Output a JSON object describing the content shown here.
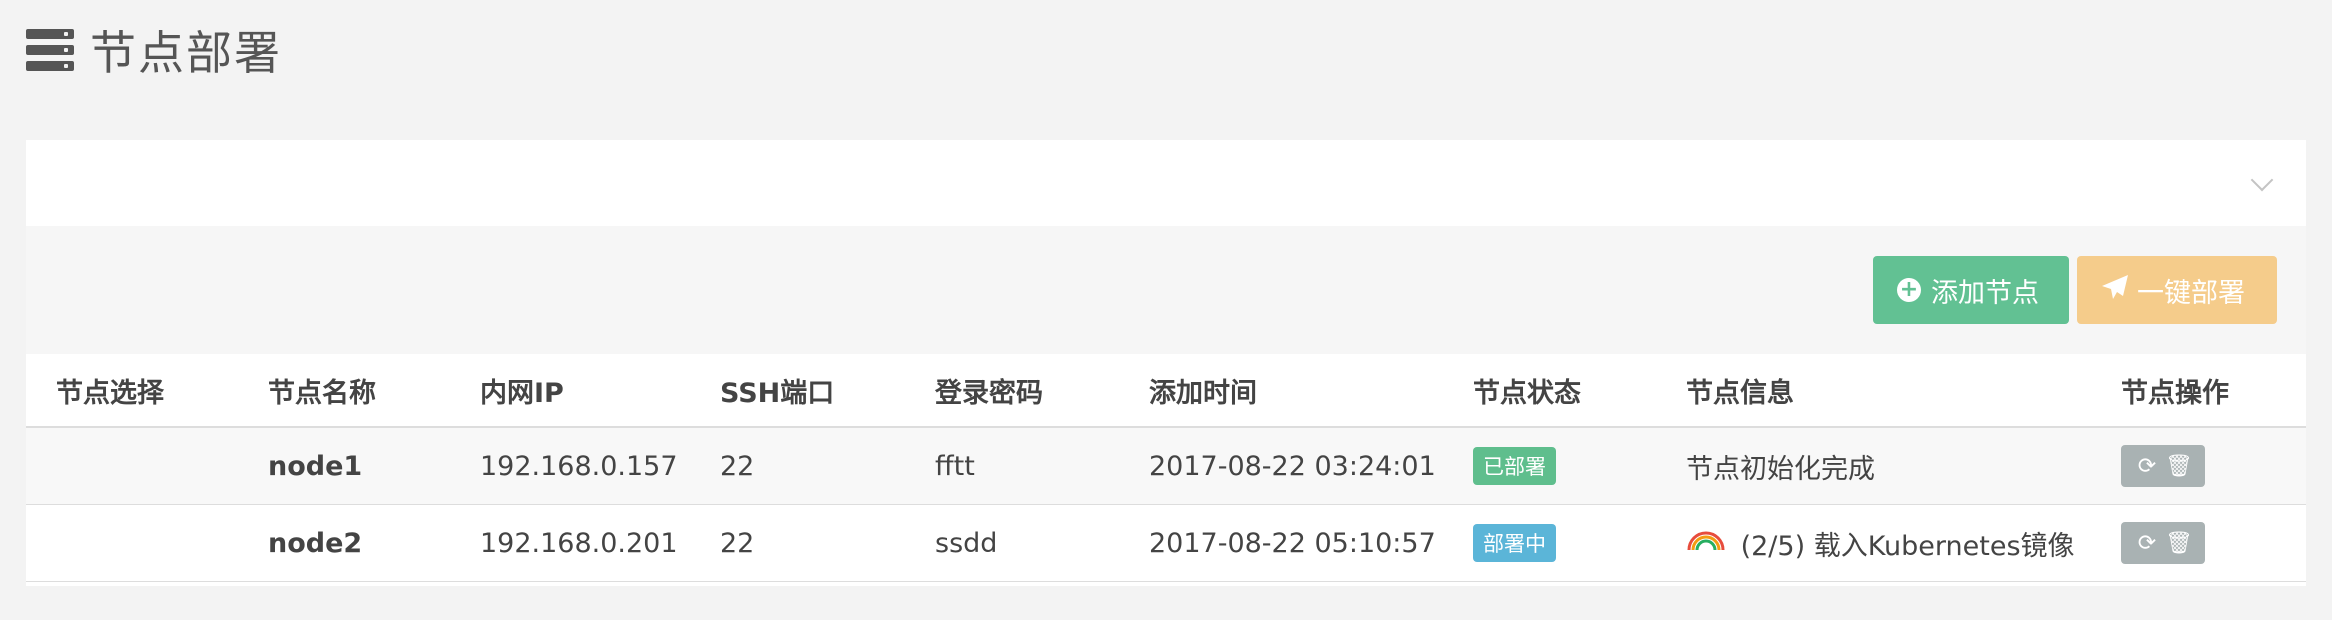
{
  "page": {
    "title": "节点部署"
  },
  "toolbar": {
    "add_label": "添加节点",
    "deploy_label": "一键部署"
  },
  "colors": {
    "add": "#62c193",
    "deploy": "#f5cc8b",
    "deployed": "#5fbe8d",
    "deploying": "#5bb5d8",
    "ops": "#a9b2b3"
  },
  "table": {
    "headers": [
      "节点选择",
      "节点名称",
      "内网IP",
      "SSH端口",
      "登录密码",
      "添加时间",
      "节点状态",
      "节点信息",
      "节点操作"
    ],
    "rows": [
      {
        "name": "node1",
        "ip": "192.168.0.157",
        "port": "22",
        "password": "fftt",
        "time": "2017-08-22 03:24:01",
        "status": "已部署",
        "info": "节点初始化完成"
      },
      {
        "name": "node2",
        "ip": "192.168.0.201",
        "port": "22",
        "password": "ssdd",
        "time": "2017-08-22 05:10:57",
        "status": "部署中",
        "info": "(2/5) 载入Kubernetes镜像"
      }
    ]
  },
  "icons": {
    "header": "server-icon",
    "add": "plus-circle-icon",
    "deploy": "paper-plane-icon",
    "refresh": "refresh-icon",
    "delete": "trash-icon",
    "collapse": "chevron-down-icon",
    "progress": "spinner-icon"
  }
}
